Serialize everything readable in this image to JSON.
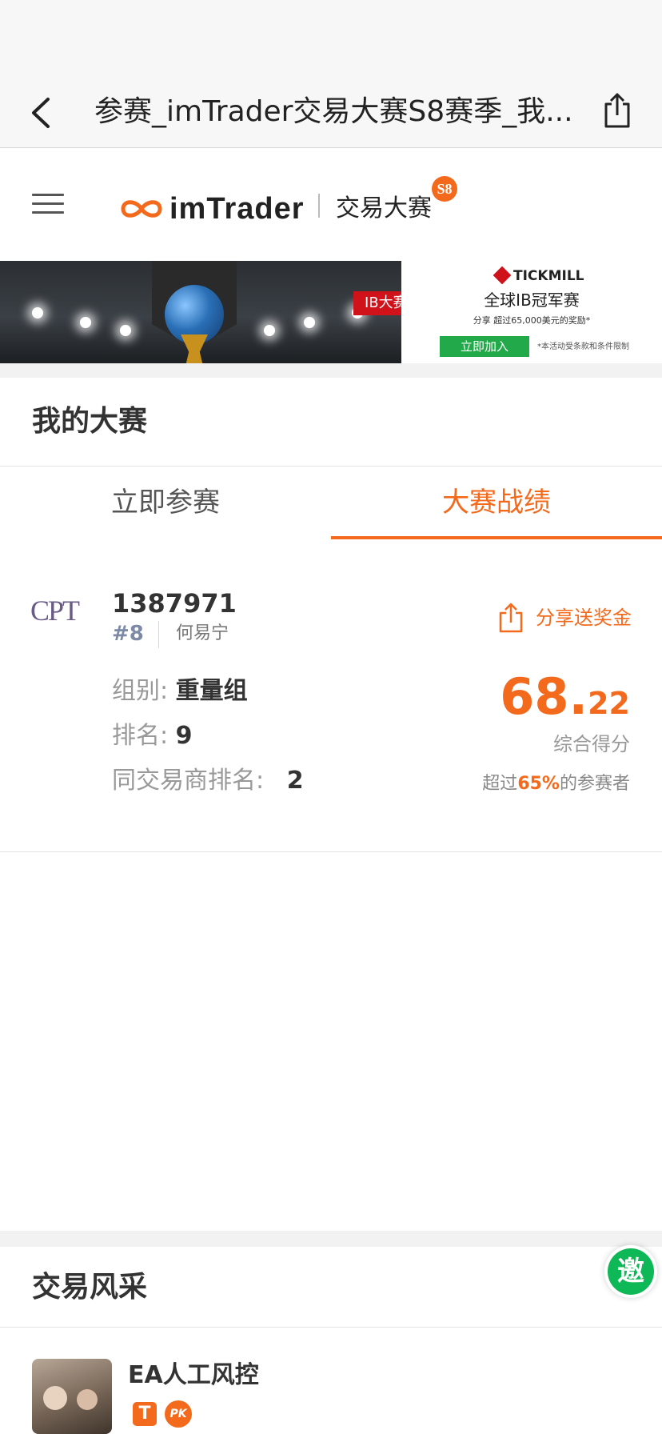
{
  "nav": {
    "title": "参赛_imTrader交易大赛S8赛季_我..."
  },
  "header": {
    "logo_text": "imTrader",
    "logo_sub": "交易大赛",
    "season_badge": "S8"
  },
  "banner": {
    "ib_tag": "IB大赛",
    "brand": "TICKMILL",
    "title": "全球IB冠军赛",
    "subtitle": "分享 超过65,000美元的奖励*",
    "join_label": "立即加入",
    "note": "*本活动受条款和条件限制"
  },
  "my_contest": {
    "title": "我的大赛",
    "tabs": [
      {
        "label": "立即参赛",
        "active": false
      },
      {
        "label": "大赛战绩",
        "active": true
      }
    ]
  },
  "record": {
    "broker_logo": "CPT",
    "account_id": "1387971",
    "rank_hash": "#8",
    "trader_name": "何易宁",
    "share_label": "分享送奖金",
    "group_label": "组别:",
    "group_value": "重量组",
    "rank_label": "排名:",
    "rank_value": "9",
    "broker_rank_label": "同交易商排名:",
    "broker_rank_value": "2",
    "score_int": "68.",
    "score_dec": "22",
    "score_label": "综合得分",
    "beat_prefix": "超过",
    "beat_pct": "65%",
    "beat_suffix": "的参赛者"
  },
  "trading_style": {
    "title": "交易风采",
    "invite_label": "邀",
    "items": [
      {
        "name": "EA人工风控",
        "badge_t": "T",
        "badge_pk": "PK"
      }
    ]
  },
  "colors": {
    "accent": "#f36a1d",
    "invite": "#0fb856",
    "tickmill_red": "#d0121b",
    "join_green": "#22a94a"
  },
  "icons": [
    "back-chevron-icon",
    "share-icon",
    "menu-icon",
    "infinity-logo-icon",
    "share-bonus-icon"
  ]
}
